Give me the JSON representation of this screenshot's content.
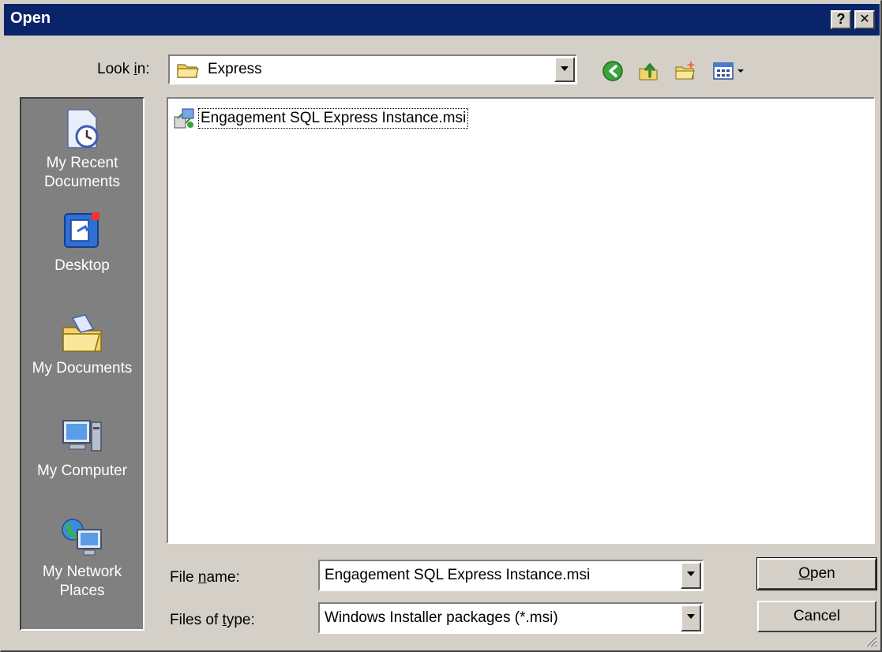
{
  "window": {
    "title": "Open",
    "help_label": "?",
    "close_label": "✕"
  },
  "toolbar": {
    "look_in_label_pre": "Look ",
    "look_in_label_u": "i",
    "look_in_label_post": "n:",
    "look_in_value": "Express",
    "icons": [
      "back-icon",
      "up-folder-icon",
      "new-folder-icon",
      "view-menu-icon"
    ]
  },
  "places": [
    {
      "label_line1": "My Recent",
      "label_line2": "Documents",
      "icon": "recent-documents-icon"
    },
    {
      "label_line1": "Desktop",
      "label_line2": "",
      "icon": "desktop-icon"
    },
    {
      "label_line1": "My Documents",
      "label_line2": "",
      "icon": "my-documents-icon"
    },
    {
      "label_line1": "My Computer",
      "label_line2": "",
      "icon": "my-computer-icon"
    },
    {
      "label_line1": "My Network",
      "label_line2": "Places",
      "icon": "network-places-icon"
    }
  ],
  "files": [
    {
      "name": "Engagement SQL Express Instance.msi",
      "icon": "msi-package-icon"
    }
  ],
  "filename": {
    "label_pre": "File ",
    "label_u": "n",
    "label_post": "ame:",
    "value": "Engagement SQL Express Instance.msi"
  },
  "filetype": {
    "label_pre": "Files of ",
    "label_u": "t",
    "label_post": "ype:",
    "value": "Windows Installer packages (*.msi)"
  },
  "buttons": {
    "open_u": "O",
    "open_rest": "pen",
    "cancel": "Cancel"
  },
  "colors": {
    "titlebar": "#0a246a",
    "face": "#d4d0c8",
    "places_bg": "#808080"
  }
}
